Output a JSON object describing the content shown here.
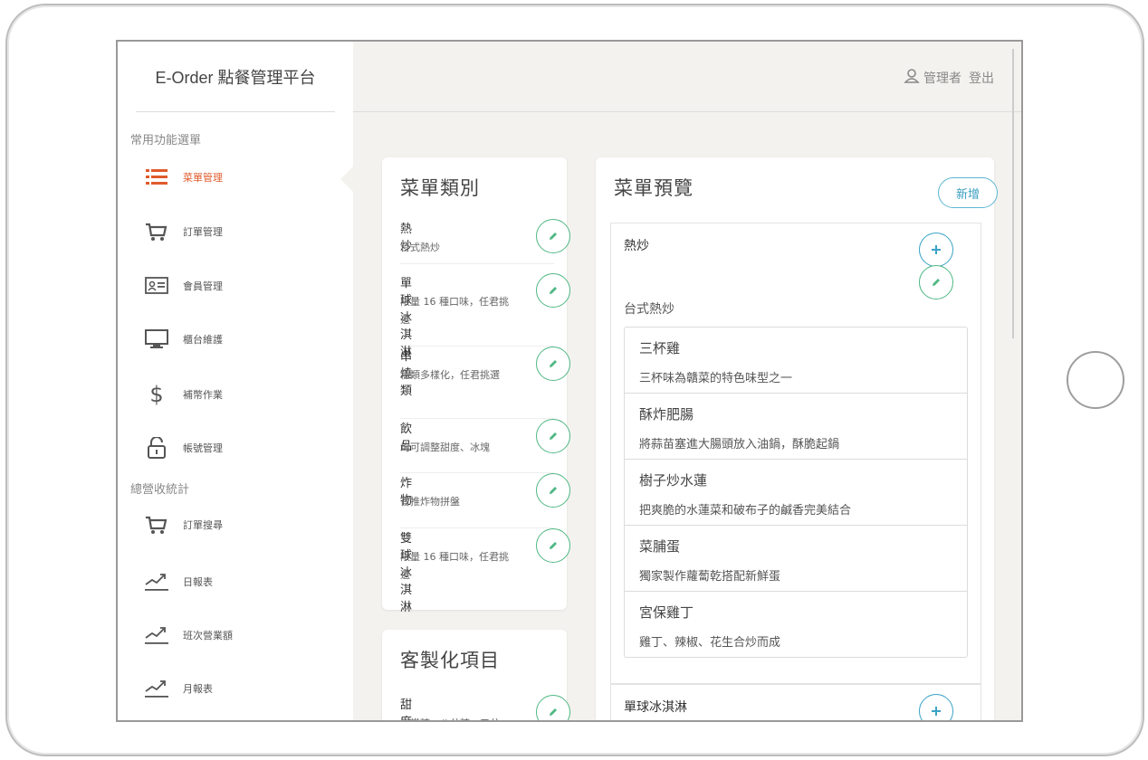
{
  "brand": "E-Order 點餐管理平台",
  "sidebar": {
    "section1": "常用功能選單",
    "items1": [
      {
        "label": "菜單管理",
        "icon": "list-icon",
        "active": true
      },
      {
        "label": "訂單管理",
        "icon": "cart-icon"
      },
      {
        "label": "會員管理",
        "icon": "id-card-icon"
      },
      {
        "label": "櫃台維護",
        "icon": "monitor-icon"
      },
      {
        "label": "補幣作業",
        "icon": "dollar-icon"
      },
      {
        "label": "帳號管理",
        "icon": "lock-icon"
      }
    ],
    "section2": "總營收統計",
    "items2": [
      {
        "label": "訂單搜尋",
        "icon": "cart-icon"
      },
      {
        "label": "日報表",
        "icon": "trend-icon"
      },
      {
        "label": "班次營業額",
        "icon": "trend-icon"
      },
      {
        "label": "月報表",
        "icon": "trend-icon"
      }
    ]
  },
  "header": {
    "user": "管理者",
    "logout": "登出"
  },
  "categories": {
    "title": "菜單類別",
    "items": [
      {
        "name": "熱炒",
        "desc": "台式熱炒"
      },
      {
        "name": "單球冰淇淋",
        "desc": "限量 16 種口味，任君挑選"
      },
      {
        "name": "串燒類",
        "desc": "種類多樣化，任君挑選"
      },
      {
        "name": "飲品",
        "desc": "均可調整甜度、冰塊"
      },
      {
        "name": "炸物",
        "desc": "首推炸物拼盤"
      },
      {
        "name": "雙球冰淇淋",
        "desc": "限量 16 種口味，任君挑選"
      }
    ]
  },
  "custom": {
    "title": "客製化項目",
    "items": [
      {
        "name": "甜度選擇",
        "desc": "正常糖、八分糖、五分"
      }
    ]
  },
  "preview": {
    "title": "菜單預覽",
    "new_label": "新增",
    "groups": [
      {
        "name": "熱炒",
        "desc": "台式熱炒",
        "items": [
          {
            "name": "三杯雞",
            "desc": "三杯味為贛菜的特色味型之一"
          },
          {
            "name": "酥炸肥腸",
            "desc": "將蒜苗塞進大腸頭放入油鍋，酥脆起鍋"
          },
          {
            "name": "樹子炒水蓮",
            "desc": "把爽脆的水蓮菜和破布子的鹹香完美結合"
          },
          {
            "name": "菜脯蛋",
            "desc": "獨家製作蘿蔔乾搭配新鮮蛋"
          },
          {
            "name": "宮保雞丁",
            "desc": "雞丁、辣椒、花生合炒而成"
          }
        ]
      },
      {
        "name": "單球冰淇淋"
      }
    ]
  },
  "colors": {
    "accent": "#e05a2b",
    "green": "#4fb883",
    "blue": "#3ba3c7"
  }
}
